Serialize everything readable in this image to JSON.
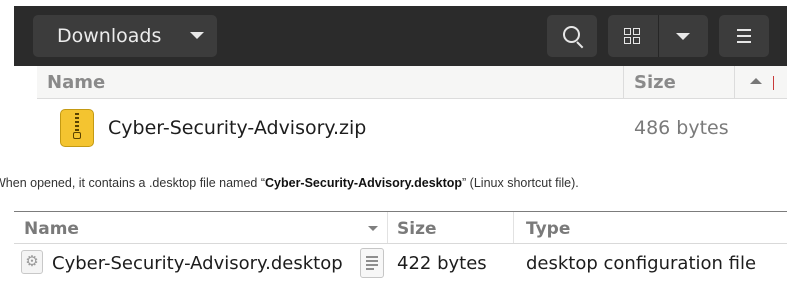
{
  "top_window": {
    "location": "Downloads",
    "columns": {
      "name": "Name",
      "size": "Size"
    },
    "file": {
      "name": "Cyber-Security-Advisory.zip",
      "size": "486 bytes",
      "icon": "zip-archive-icon"
    },
    "icons": [
      "search-icon",
      "grid-view-icon",
      "chevron-down-icon",
      "hamburger-menu-icon"
    ]
  },
  "caption": {
    "before": "When opened, it contains a .desktop file named “",
    "filename": "Cyber-Security-Advisory.desktop",
    "after": "” (Linux shortcut file)."
  },
  "bottom_window": {
    "columns": {
      "name": "Name",
      "size": "Size",
      "type": "Type"
    },
    "file": {
      "name": "Cyber-Security-Advisory.desktop",
      "size": "422 bytes",
      "type": "desktop configuration file",
      "icon": "gear-icon"
    }
  },
  "colors": {
    "headerbar": "#2b2b2b",
    "button": "#3c3c3c",
    "zip_icon": "#f4c430"
  }
}
